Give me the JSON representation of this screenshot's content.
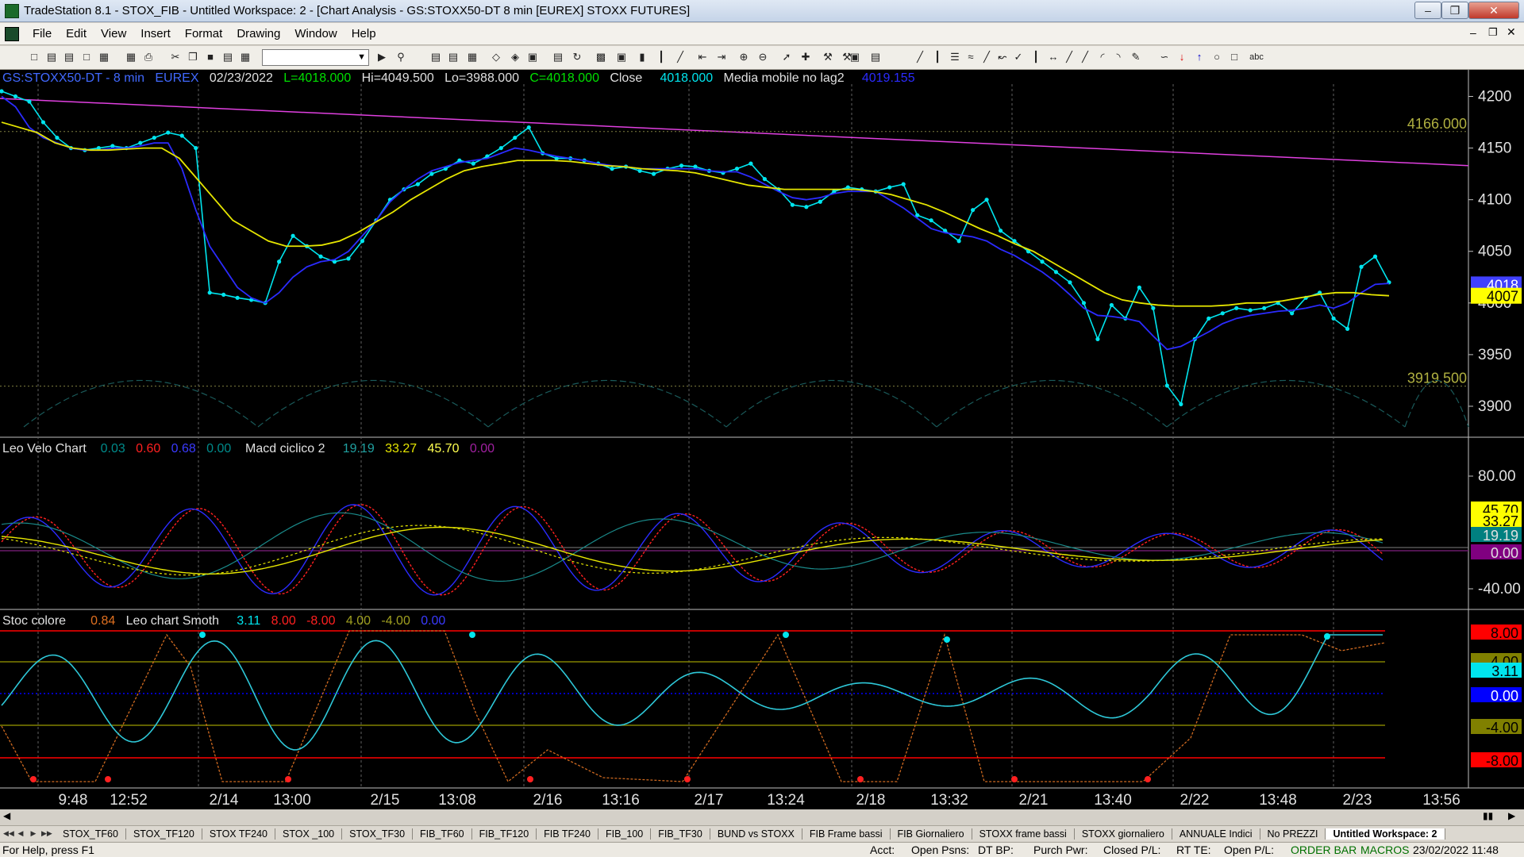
{
  "window": {
    "title": "TradeStation 8.1 - STOX_FIB - Untitled Workspace:  2 - [Chart Analysis - GS:STOXX50-DT  8 min  [EUREX] STOXX FUTURES]"
  },
  "menu": [
    "File",
    "Edit",
    "View",
    "Insert",
    "Format",
    "Drawing",
    "Window",
    "Help"
  ],
  "toolbar": {
    "text_tool_label": "abc",
    "symbol_value": ""
  },
  "chart_data": [
    {
      "type": "line",
      "title": "GS:STOXX50-DT - 8 min",
      "header": {
        "symbol": "GS:STOXX50-DT - 8 min",
        "exchange": "EUREX",
        "date": "02/23/2022",
        "last": "L=4018.000",
        "high": "Hi=4049.500",
        "low": "Lo=3988.000",
        "close_field": "C=4018.000",
        "close_label": "Close",
        "close_value": "4018.000",
        "ma_label": "Media mobile no lag2",
        "ma_value": "4019.155"
      },
      "y_ticks": [
        "4200",
        "4150",
        "4100",
        "4050",
        "4000",
        "3950",
        "3900"
      ],
      "ylim": [
        3880,
        4215
      ],
      "levels": [
        {
          "label": "4166.000",
          "value": 4166
        },
        {
          "label": "3919.500",
          "value": 3919.5
        }
      ],
      "price_labels": [
        {
          "label": "4018",
          "color": "#4040ff"
        },
        {
          "label": "4007",
          "color": "#ffff00"
        }
      ],
      "x_labels": [
        "9:48",
        "12:52",
        "2/14",
        "13:00",
        "2/15",
        "13:08",
        "2/16",
        "13:16",
        "2/17",
        "13:24",
        "2/18",
        "13:32",
        "2/21",
        "13:40",
        "2/22",
        "13:48",
        "2/23",
        "13:56"
      ],
      "series": [
        {
          "name": "Close",
          "color": "#00e5ee",
          "values": [
            4205,
            4200,
            4195,
            4175,
            4160,
            4150,
            4148,
            4150,
            4152,
            4150,
            4155,
            4160,
            4165,
            4162,
            4150,
            4010,
            4008,
            4005,
            4003,
            4000,
            4040,
            4065,
            4055,
            4045,
            4040,
            4043,
            4060,
            4080,
            4100,
            4110,
            4115,
            4125,
            4130,
            4138,
            4135,
            4142,
            4150,
            4160,
            4170,
            4145,
            4140,
            4140,
            4138,
            4135,
            4130,
            4132,
            4128,
            4125,
            4130,
            4133,
            4132,
            4128,
            4126,
            4130,
            4135,
            4120,
            4110,
            4095,
            4093,
            4098,
            4108,
            4112,
            4110,
            4108,
            4112,
            4115,
            4085,
            4080,
            4070,
            4060,
            4090,
            4100,
            4070,
            4060,
            4050,
            4040,
            4030,
            4020,
            4000,
            3965,
            3998,
            3985,
            4015,
            3995,
            3920,
            3902,
            3965,
            3985,
            3990,
            3995,
            3993,
            3995,
            4000,
            3990,
            4005,
            4010,
            3985,
            3975,
            4035,
            4045,
            4020
          ]
        },
        {
          "name": "Media mobile no lag2",
          "color": "#2b2bff",
          "values": [
            4200,
            4190,
            4170,
            4160,
            4155,
            4150,
            4148,
            4148,
            4150,
            4150,
            4152,
            4155,
            4155,
            4130,
            4090,
            4055,
            4035,
            4015,
            4005,
            4000,
            4010,
            4025,
            4035,
            4040,
            4042,
            4050,
            4065,
            4080,
            4098,
            4110,
            4120,
            4128,
            4132,
            4136,
            4138,
            4140,
            4145,
            4150,
            4148,
            4145,
            4142,
            4140,
            4138,
            4135,
            4133,
            4132,
            4130,
            4130,
            4130,
            4130,
            4130,
            4128,
            4127,
            4127,
            4122,
            4115,
            4108,
            4102,
            4100,
            4102,
            4106,
            4108,
            4108,
            4108,
            4100,
            4092,
            4082,
            4072,
            4068,
            4066,
            4064,
            4060,
            4052,
            4046,
            4038,
            4030,
            4020,
            4008,
            3995,
            3988,
            3987,
            3985,
            3982,
            3968,
            3955,
            3958,
            3965,
            3972,
            3980,
            3985,
            3988,
            3990,
            3992,
            3993,
            3995,
            3998,
            3995,
            4000,
            4010,
            4018,
            4019
          ]
        },
        {
          "name": "",
          "color": "#e6e600",
          "values": [
            4175,
            4170,
            4165,
            4155,
            4150,
            4148,
            4148,
            4149,
            4150,
            4150,
            4140,
            4120,
            4100,
            4080,
            4070,
            4060,
            4055,
            4055,
            4056,
            4060,
            4068,
            4078,
            4088,
            4100,
            4110,
            4120,
            4128,
            4132,
            4135,
            4138,
            4138,
            4138,
            4137,
            4135,
            4133,
            4132,
            4130,
            4129,
            4128,
            4126,
            4122,
            4118,
            4114,
            4112,
            4110,
            4110,
            4110,
            4110,
            4110,
            4108,
            4105,
            4100,
            4095,
            4088,
            4080,
            4072,
            4065,
            4057,
            4050,
            4040,
            4030,
            4020,
            4010,
            4003,
            4000,
            3998,
            3997,
            3997,
            3997,
            3998,
            4000,
            4000,
            4002,
            4005,
            4008,
            4010,
            4010,
            4008,
            4007
          ]
        }
      ]
    },
    {
      "type": "line",
      "header": {
        "name1": "Leo Velo Chart",
        "v1": "0.03",
        "v2": "0.60",
        "v3": "0.68",
        "v4": "0.00",
        "name2": "Macd ciclico 2",
        "v5": "19.19",
        "v6": "33.27",
        "v7": "45.70",
        "v8": "0.00"
      },
      "y_ticks": [
        "80.00",
        "-40.00"
      ],
      "price_labels": [
        {
          "label": "45.70",
          "color": "#ffff00"
        },
        {
          "label": "33.27",
          "color": "#ffff00"
        },
        {
          "label": "19.19",
          "color": "#008080"
        },
        {
          "label": "0.00",
          "color": "#800080"
        }
      ]
    },
    {
      "type": "line",
      "header": {
        "name1": "Stoc colore",
        "v1": "0.84",
        "name2": "Leo chart Smoth",
        "v2": "3.11",
        "v3": "8.00",
        "v4": "-8.00",
        "v5": "4.00",
        "v6": "-4.00",
        "v7": "0.00"
      },
      "price_labels": [
        {
          "label": "8.00",
          "color": "#ff0000"
        },
        {
          "label": "4.00",
          "color": "#808000"
        },
        {
          "label": "3.11",
          "color": "#00e5ee"
        },
        {
          "label": "0.00",
          "color": "#0000ff"
        },
        {
          "label": "-4.00",
          "color": "#808000"
        },
        {
          "label": "-8.00",
          "color": "#ff0000"
        }
      ]
    }
  ],
  "tabs": [
    "STOX_TF60",
    "STOX_TF120",
    "STOX TF240",
    "STOX _100",
    "STOX_TF30",
    "FIB_TF60",
    "FIB_TF120",
    "FIB TF240",
    "FIB_100",
    "FIB_TF30",
    "BUND vs STOXX",
    "FIB Frame bassi",
    "FIB Giornaliero",
    "STOXX frame bassi",
    "STOXX giornaliero",
    "ANNUALE Indici",
    "No PREZZI",
    "Untitled Workspace:  2"
  ],
  "status": {
    "help": "For Help, press F1",
    "acct": "Acct:",
    "open_psns": "Open Psns:",
    "dt_bp": "DT BP:",
    "purch_pwr": "Purch Pwr:",
    "closed_pl": "Closed P/L:",
    "rt_te": "RT TE:",
    "open_pl": "Open P/L:",
    "order_bar": "ORDER BAR",
    "macros": "MACROS",
    "datetime": "23/02/2022 11:48"
  }
}
